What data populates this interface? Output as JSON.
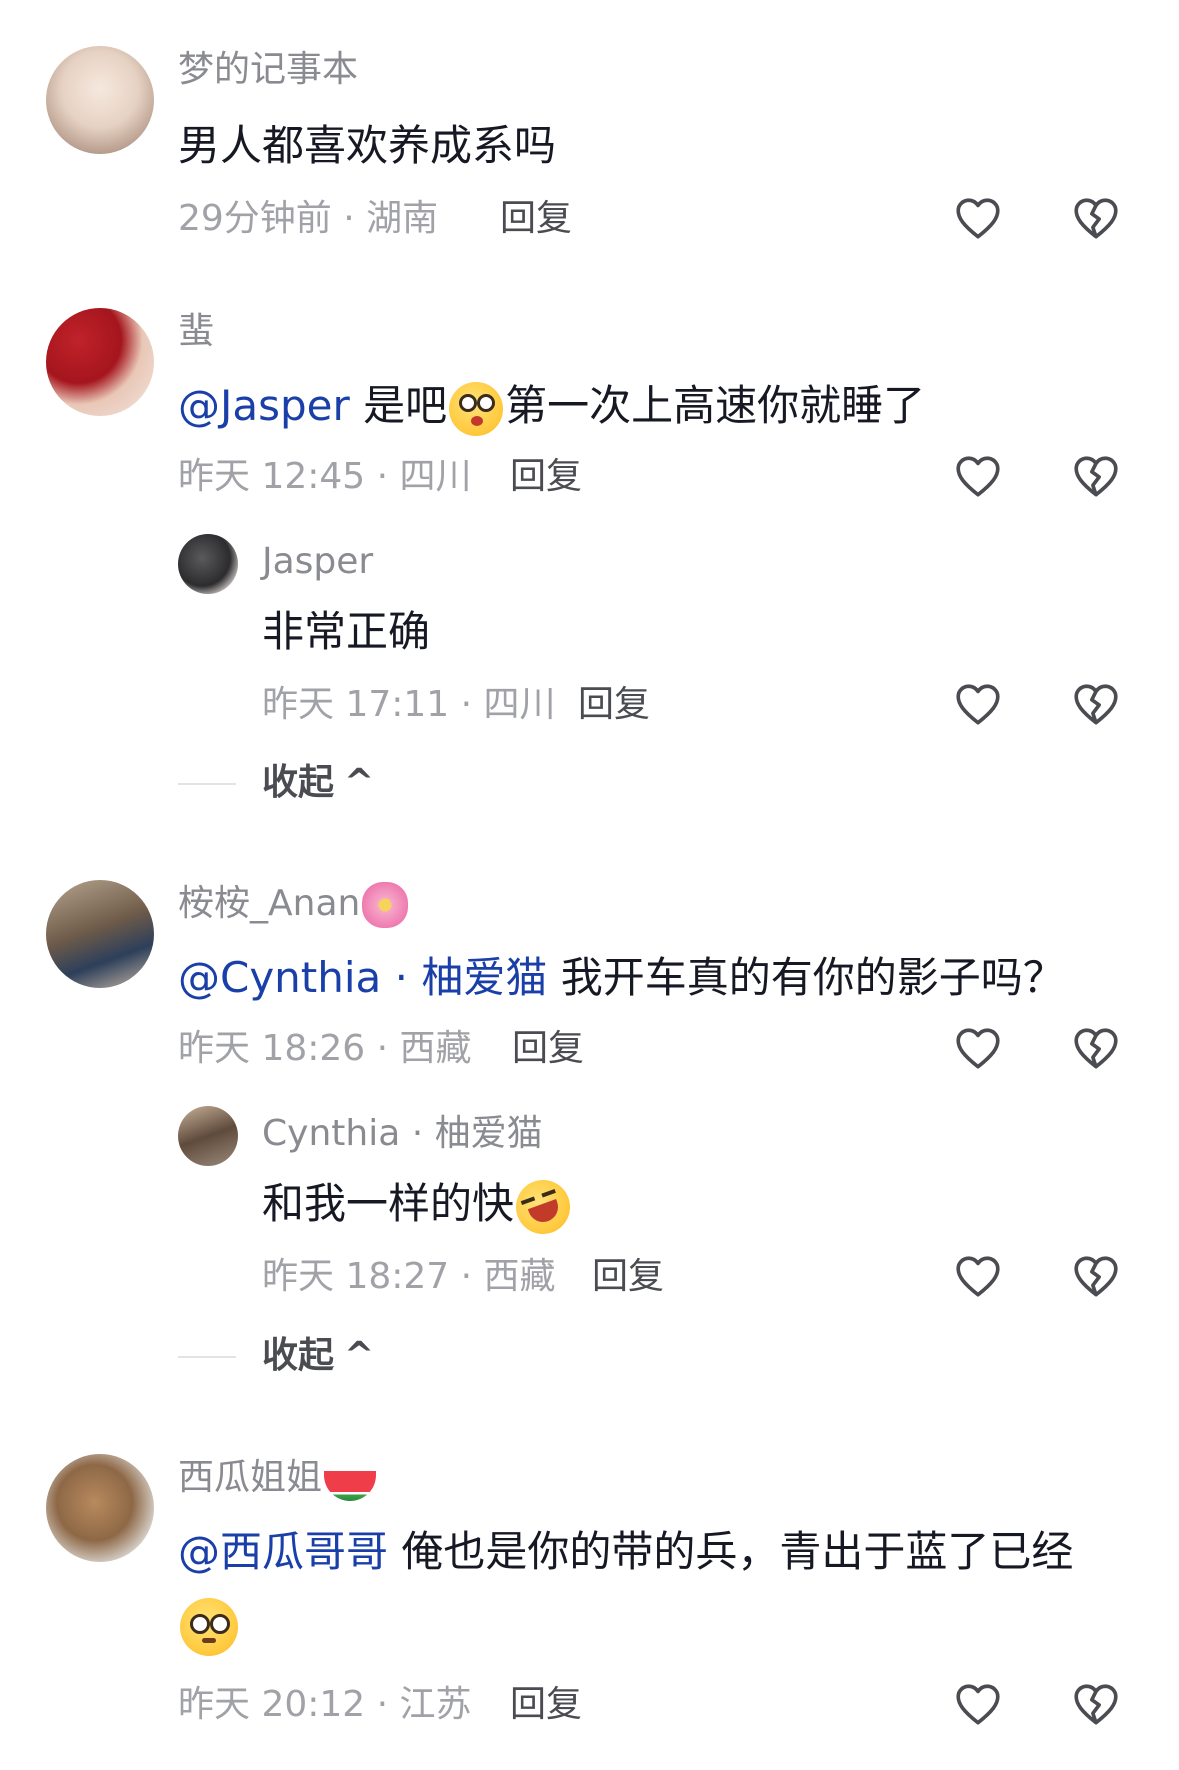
{
  "comments": [
    {
      "name": "梦的记事本",
      "text": "男人都喜欢养成系吗",
      "meta": "29分钟前 · 湖南",
      "reply": "回复"
    },
    {
      "name": "蜚",
      "mention": "@Jasper",
      "text_before_emoji": " 是吧",
      "emoji": "kissing-face-emoji",
      "text_after_emoji": "第一次上高速你就睡了",
      "meta": "昨天 12:45 · 四川",
      "reply": "回复",
      "replies": [
        {
          "name": "Jasper",
          "text": "非常正确",
          "meta": "昨天 17:11 · 四川",
          "reply": "回复"
        }
      ],
      "collapse": "收起"
    },
    {
      "name": "桉桉_Anan",
      "name_emoji": "cherry-blossom-emoji",
      "mention": "@Cynthia · 柚爱猫",
      "text": " 我开车真的有你的影子吗？",
      "meta": "昨天 18:26 · 西藏",
      "reply": "回复",
      "replies": [
        {
          "name": "Cynthia · 柚爱猫",
          "text": "和我一样的快",
          "emoji": "rolling-laughing-emoji",
          "meta": "昨天 18:27 · 西藏",
          "reply": "回复"
        }
      ],
      "collapse": "收起"
    },
    {
      "name": "西瓜姐姐",
      "name_emoji": "watermelon-emoji",
      "mention": "@西瓜哥哥",
      "text": " 俺也是你的带的兵，青出于蓝了已经",
      "emoji": "flushed-face-emoji",
      "meta": "昨天 20:12 · 江苏",
      "reply": "回复"
    }
  ],
  "colors": {
    "mention": "#1a3fa8",
    "name": "#8a8b91",
    "meta": "#a1a2a7",
    "body_text": "#161823"
  },
  "icons": {
    "like": "heart-icon",
    "dislike": "broken-heart-icon",
    "collapse": "chevron-up-icon"
  }
}
